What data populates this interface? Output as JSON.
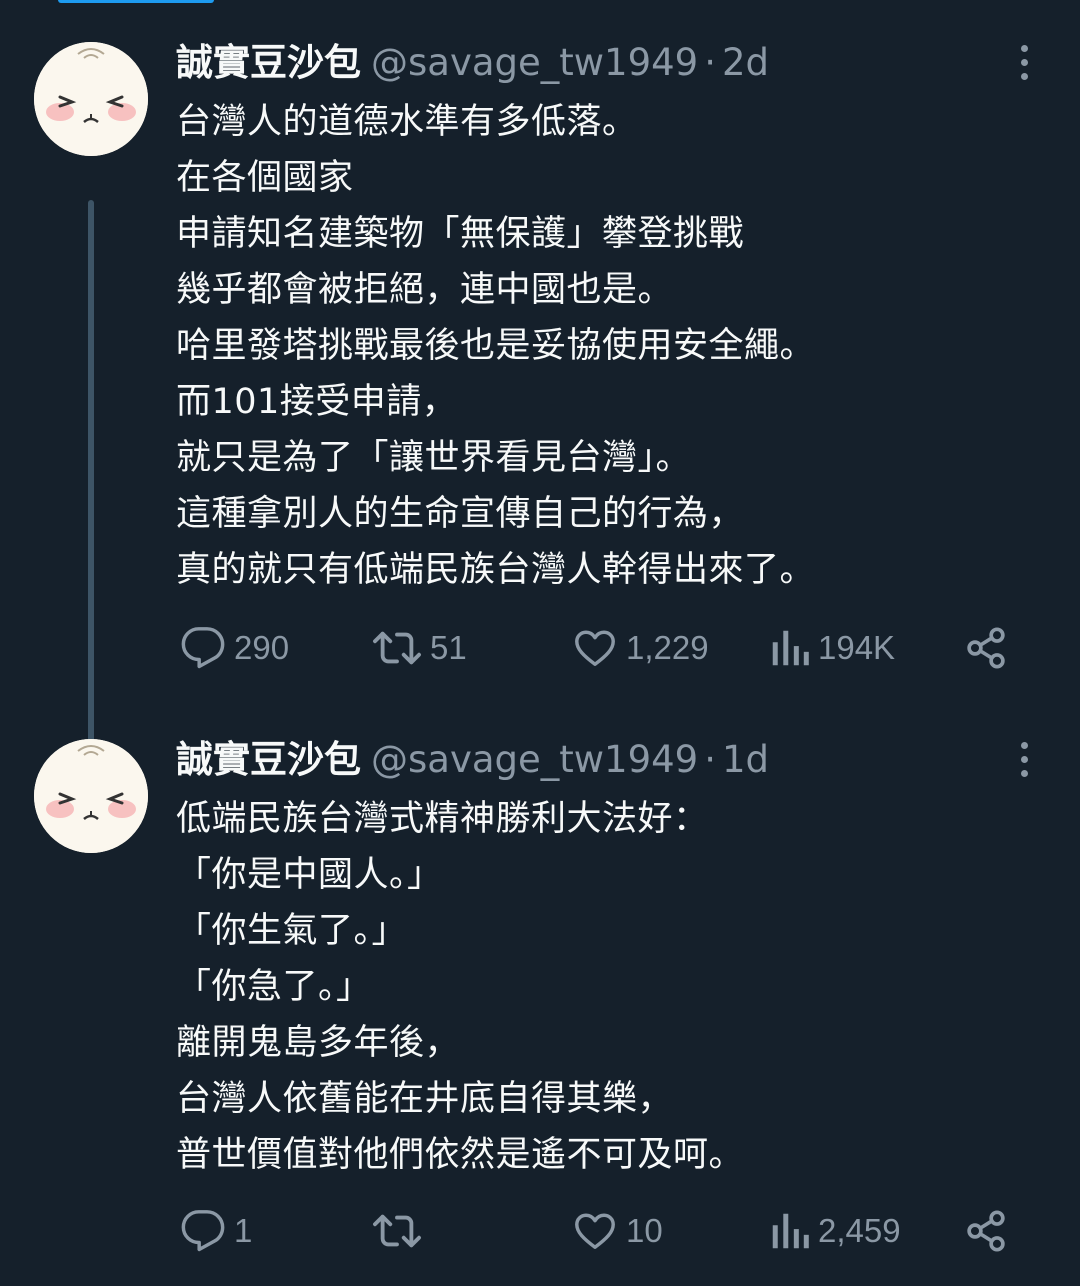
{
  "colors": {
    "background": "#15202b",
    "text_primary": "#f7f9f9",
    "text_secondary": "#8b98a5",
    "thread_line": "#3d5466",
    "accent": "#1d9bf0"
  },
  "icons": {
    "reply": "speech-bubble-icon",
    "retweet": "retweet-arrows-icon",
    "like": "heart-icon",
    "views": "bar-chart-icon",
    "share": "share-nodes-icon",
    "more": "vertical-ellipsis-icon"
  },
  "tweets": [
    {
      "display_name": "誠實豆沙包",
      "handle": "@savage_tw1949",
      "separator": "·",
      "time": "2d",
      "text_lines": [
        "台灣人的道德水準有多低落。",
        "在各個國家",
        "申請知名建築物「無保護」攀登挑戰",
        "幾乎都會被拒絕，連中國也是。",
        "哈里發塔挑戰最後也是妥協使用安全繩。",
        "而101接受申請，",
        "就只是為了「讓世界看見台灣」。",
        "這種拿別人的生命宣傳自己的行為，",
        "真的就只有低端民族台灣人幹得出來了。"
      ],
      "replies": "290",
      "retweets": "51",
      "likes": "1,229",
      "views": "194K"
    },
    {
      "display_name": "誠實豆沙包",
      "handle": "@savage_tw1949",
      "separator": "·",
      "time": "1d",
      "text_lines": [
        "低端民族台灣式精神勝利大法好：",
        "「你是中國人。」",
        "「你生氣了。」",
        "「你急了。」",
        "離開鬼島多年後，",
        "台灣人依舊能在井底自得其樂，",
        "普世價值對他們依然是遙不可及呵。"
      ],
      "replies": "1",
      "retweets": "",
      "likes": "10",
      "views": "2,459"
    }
  ]
}
